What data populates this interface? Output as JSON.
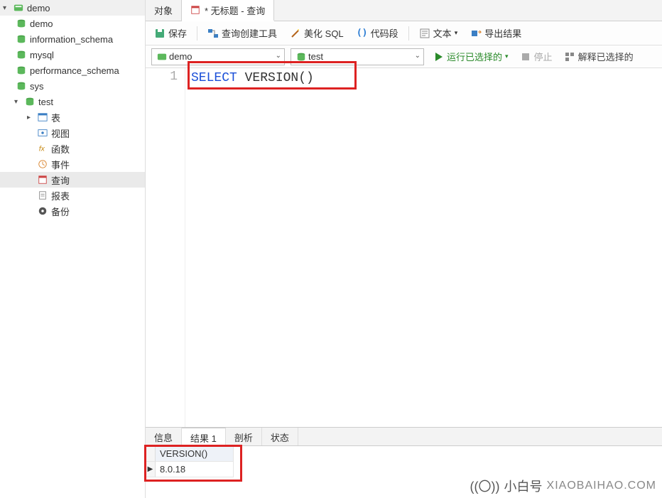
{
  "sidebar": {
    "connection": "demo",
    "databases": [
      "demo",
      "information_schema",
      "mysql",
      "performance_schema",
      "sys",
      "test"
    ],
    "test_children": {
      "tables": "表",
      "views": "视图",
      "functions": "函数",
      "events": "事件",
      "queries": "查询",
      "reports": "报表",
      "backups": "备份"
    }
  },
  "tabs": {
    "objects": "对象",
    "query": "* 无标题 - 查询"
  },
  "toolbar": {
    "save": "保存",
    "query_builder": "查询创建工具",
    "beautify": "美化 SQL",
    "snippet": "代码段",
    "text": "文本",
    "export": "导出结果"
  },
  "selector": {
    "db": "demo",
    "table": "test"
  },
  "runbar": {
    "run": "运行已选择的",
    "stop": "停止",
    "explain": "解释已选择的"
  },
  "editor": {
    "line_no": "1",
    "keyword": "SELECT",
    "func": "VERSION()"
  },
  "result_tabs": {
    "info": "信息",
    "result": "结果 1",
    "profile": "剖析",
    "status": "状态"
  },
  "result": {
    "col1": "VERSION()",
    "val1": "8.0.18"
  },
  "watermark": {
    "cn": "小白号",
    "en": "XIAOBAIHAO.COM"
  }
}
